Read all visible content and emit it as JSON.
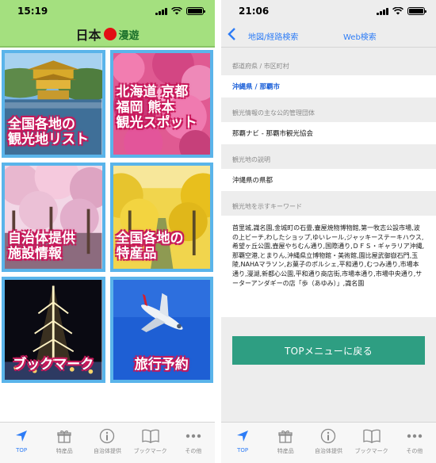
{
  "left": {
    "status": {
      "time": "15:19"
    },
    "header": {
      "logo_part1": "日本",
      "logo_part2": "漫遊"
    },
    "tiles": [
      {
        "label": "全国各地の\n観光地リスト"
      },
      {
        "label": "北海道 京都\n福岡 熊本\n観光スポット"
      },
      {
        "label": "自治体提供\n施設情報"
      },
      {
        "label": "全国各地の\n特産品"
      },
      {
        "label": "ブックマーク"
      },
      {
        "label": "旅行予約"
      }
    ],
    "tabbar": [
      {
        "label": "TOP",
        "icon": "location-arrow-icon"
      },
      {
        "label": "特産品",
        "icon": "gift-icon"
      },
      {
        "label": "自治体提供",
        "icon": "info-icon"
      },
      {
        "label": "ブックマーク",
        "icon": "book-icon"
      },
      {
        "label": "その他",
        "icon": "more-icon"
      }
    ]
  },
  "right": {
    "status": {
      "time": "21:06"
    },
    "nav": {
      "map_link": "地図/経路検索",
      "web_link": "Web検索"
    },
    "fields": {
      "pref_label": "都道府県 / 市区町村",
      "pref_value": "沖縄県 / 那覇市",
      "org_label": "観光情報の主な公的管理団体",
      "org_value": "那覇ナビ - 那覇市観光協会",
      "desc_label": "観光地の説明",
      "desc_value": "沖縄県の県都",
      "kw_label": "観光地を示すキーワード",
      "kw_value": "首里城,識名園,金城町の石畳,壷屋焼物博物館,第一牧志公設市場,波の上ビーチ,わしたショップ,ゆいレール,ジャッキーステーキハウス,希望ヶ丘公園,壺屋やちむん通り,国際通り,ＤＦＳ・ギャラリア沖縄,那覇空港,とまりん,沖縄県立博物館・美術館,園比屋武御嶽石門,玉陵,NAHAマラソン,お菓子のポルシェ,平和通り,むつみ通り,市場本通り,漫湖,新都心公園,平和通り商店街,市場本通り,市場中央通り,サーターアンダギーの店「歩（あゆみ）」,識名園"
    },
    "top_button": "TOPメニューに戻る",
    "tabbar": [
      {
        "label": "TOP",
        "icon": "location-arrow-icon"
      },
      {
        "label": "特産品",
        "icon": "gift-icon"
      },
      {
        "label": "自治体提供",
        "icon": "info-icon"
      },
      {
        "label": "ブックマーク",
        "icon": "book-icon"
      },
      {
        "label": "その他",
        "icon": "more-icon"
      }
    ]
  }
}
